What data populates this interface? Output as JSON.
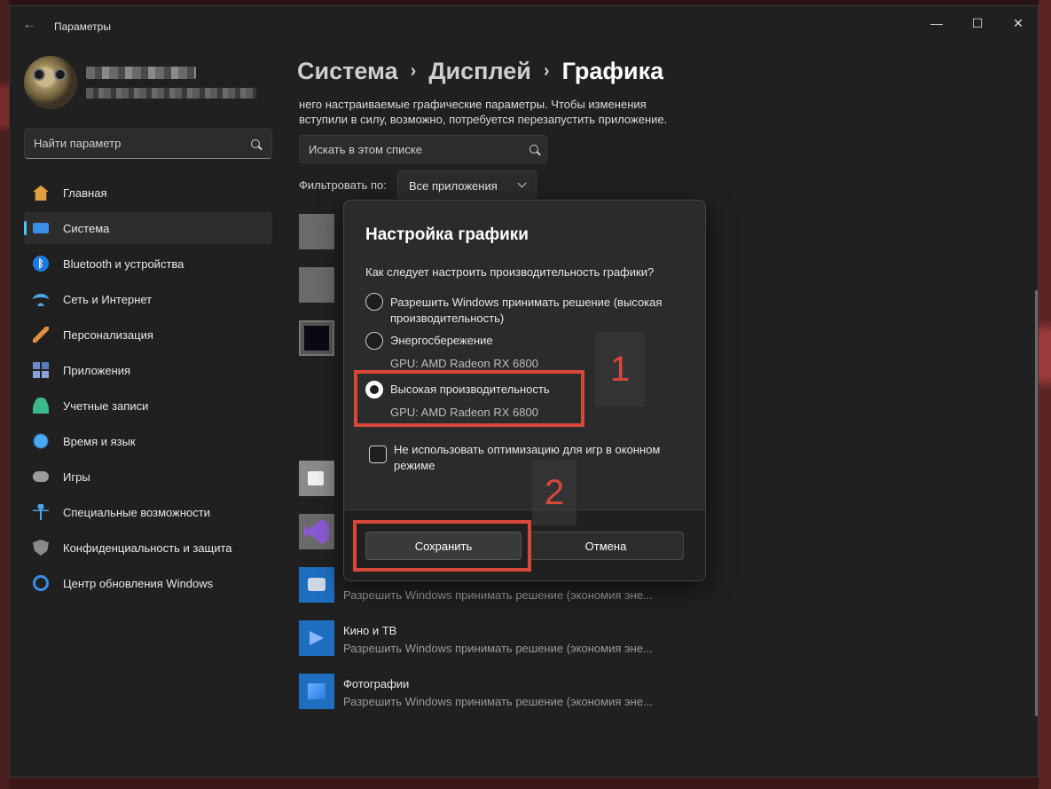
{
  "window": {
    "title": "Параметры",
    "controls": {
      "minimize": "—",
      "maximize": "☐",
      "close": "✕"
    }
  },
  "sidebar": {
    "search_placeholder": "Найти параметр",
    "items": [
      {
        "label": "Главная",
        "icon": "home-icon"
      },
      {
        "label": "Система",
        "icon": "system-icon",
        "active": true
      },
      {
        "label": "Bluetooth и устройства",
        "icon": "bluetooth-icon"
      },
      {
        "label": "Сеть и Интернет",
        "icon": "wifi-icon"
      },
      {
        "label": "Персонализация",
        "icon": "brush-icon"
      },
      {
        "label": "Приложения",
        "icon": "apps-icon"
      },
      {
        "label": "Учетные записи",
        "icon": "user-icon"
      },
      {
        "label": "Время и язык",
        "icon": "globe-clock-icon"
      },
      {
        "label": "Игры",
        "icon": "gamepad-icon"
      },
      {
        "label": "Специальные возможности",
        "icon": "accessibility-icon"
      },
      {
        "label": "Конфиденциальность и защита",
        "icon": "shield-icon"
      },
      {
        "label": "Центр обновления Windows",
        "icon": "update-icon"
      }
    ]
  },
  "breadcrumb": {
    "parts": [
      "Система",
      "Дисплей",
      "Графика"
    ]
  },
  "main": {
    "description_line1": "него настраиваемые графические параметры. Чтобы изменения",
    "description_line2": "вступили в силу, возможно, потребуется перезапустить приложение.",
    "search_placeholder": "Искать в этом списке",
    "filter_label": "Фильтровать по:",
    "filter_value": "Все приложения",
    "apps": [
      {
        "name": "",
        "sub": "Разрешить Windows принимать решение (экономия эне..."
      },
      {
        "name": "Кино и ТВ",
        "sub": "Разрешить Windows принимать решение (экономия эне..."
      },
      {
        "name": "Фотографии",
        "sub": "Разрешить Windows принимать решение (экономия эне..."
      }
    ]
  },
  "dialog": {
    "title": "Настройка графики",
    "question": "Как следует настроить производительность графики?",
    "options": [
      {
        "label": "Разрешить Windows принимать решение (высокая производительность)",
        "sub": "",
        "checked": false
      },
      {
        "label": "Энергосбережение",
        "sub": "GPU: AMD Radeon RX 6800",
        "checked": false
      },
      {
        "label": "Высокая производительность",
        "sub": "GPU: AMD Radeon RX 6800",
        "checked": true
      }
    ],
    "checkbox_label": "Не использовать оптимизацию для игр в оконном режиме",
    "save_label": "Сохранить",
    "cancel_label": "Отмена"
  },
  "annotations": {
    "step1": "1",
    "step2": "2",
    "color": "#d9473b"
  },
  "colors": {
    "accent": "#4cc2ff",
    "window_bg": "#202020",
    "dialog_bg": "#2b2b2b"
  }
}
